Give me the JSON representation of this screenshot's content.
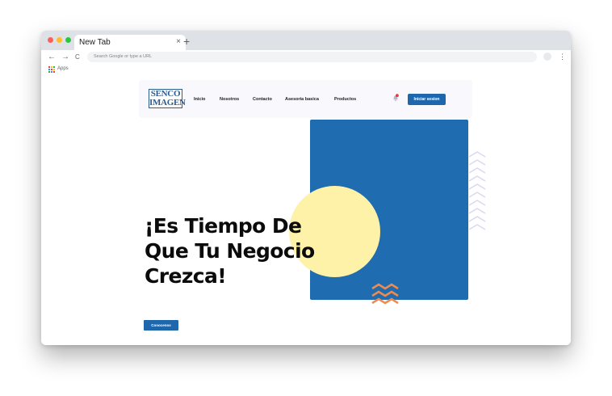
{
  "browser": {
    "tab_title": "New Tab",
    "tab_close_glyph": "×",
    "new_tab_glyph": "+",
    "back_glyph": "←",
    "forward_glyph": "→",
    "reload_glyph": "C",
    "omnibox_placeholder": "Search Google or type a URL",
    "menu_glyph": "⋮",
    "bookmarks_apps_label": "Apps",
    "traffic_light_colors": [
      "#ff5f57",
      "#febc2e",
      "#28c840"
    ]
  },
  "site": {
    "logo_line1": "SENCO",
    "logo_line2": "IMAGEN",
    "nav": [
      "Inicio",
      "Nosotros",
      "Contacto",
      "Asesoria basica",
      "Productos"
    ],
    "login_label": "Iniciar sesion",
    "headline_line1": "¡Es Tiempo De",
    "headline_line2": "Que Tu Negocio",
    "headline_line3": "Crezca!",
    "cta_label": "Conocenos",
    "colors": {
      "primary_blue": "#1f6cb0",
      "circle_yellow": "#fdf2a8",
      "chevron_lavender": "#d9d9f3",
      "chevron_orange": "#f28a4c",
      "notification_red": "#e53935"
    },
    "icons": [
      "bell-icon",
      "chevron-pattern-icon"
    ]
  }
}
